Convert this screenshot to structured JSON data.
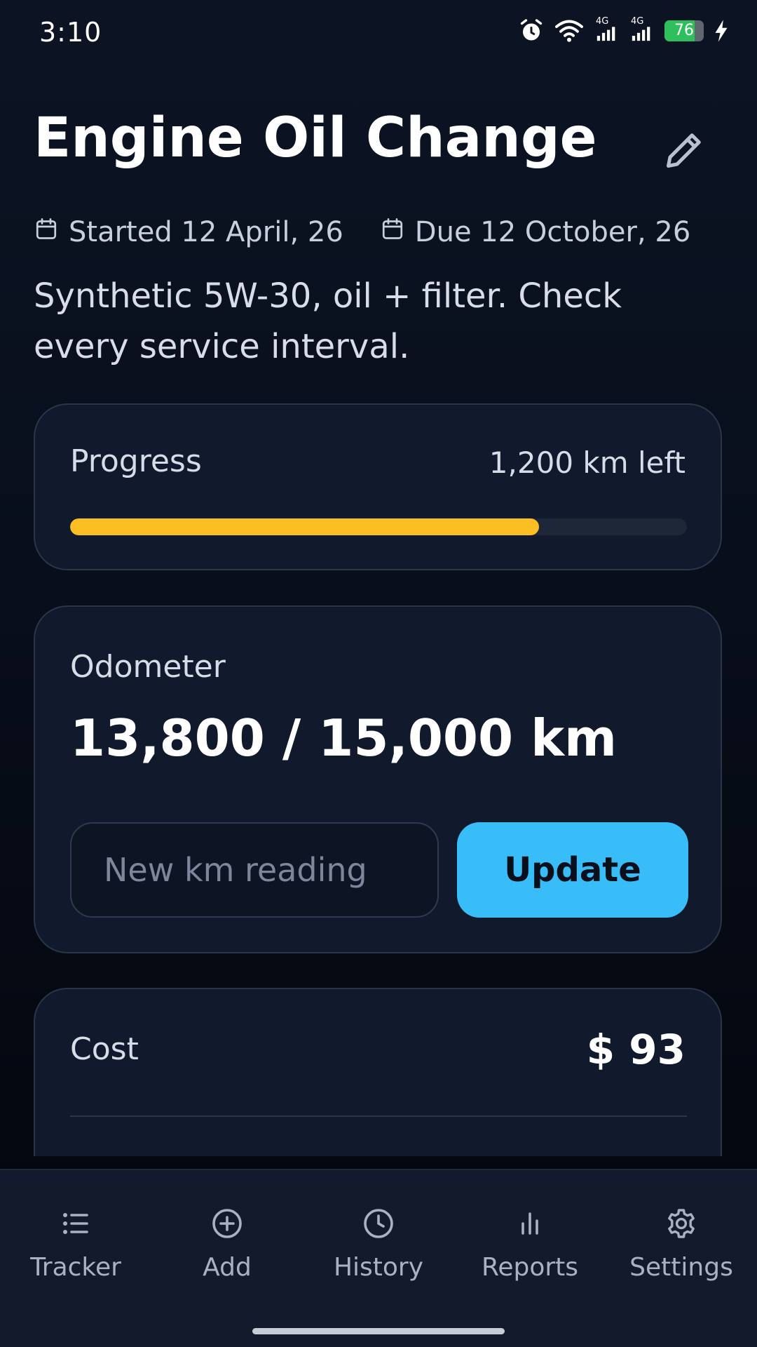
{
  "status_bar": {
    "time": "3:10",
    "network_1": "4G",
    "network_2": "4G",
    "battery_level": "76",
    "icons": [
      "alarm-icon",
      "wifi-icon",
      "signal-icon",
      "signal-icon",
      "battery-icon",
      "charging-icon"
    ],
    "colors": {
      "battery": "#2fbf5c"
    }
  },
  "header": {
    "title": "Engine Oil Change",
    "edit_icon": "pencil-icon",
    "started": "Started 12 April, 26",
    "due": "Due 12 October, 26",
    "description": "Synthetic 5W-30, oil + filter. Check every service interval."
  },
  "progress": {
    "label": "Progress",
    "remaining": "1,200 km left",
    "fraction": 0.76,
    "color": "#fbbf24"
  },
  "odometer": {
    "label": "Odometer",
    "value": "13,800 / 15,000 km",
    "input_placeholder": "New km reading",
    "input_value": "",
    "update_label": "Update",
    "button_color": "#38bdf8"
  },
  "cost": {
    "label": "Cost",
    "value": "$ 93"
  },
  "nav": {
    "items": [
      {
        "label": "Tracker",
        "icon": "list-icon"
      },
      {
        "label": "Add",
        "icon": "plus-circle-icon"
      },
      {
        "label": "History",
        "icon": "clock-icon"
      },
      {
        "label": "Reports",
        "icon": "bar-chart-icon"
      },
      {
        "label": "Settings",
        "icon": "gear-icon"
      }
    ]
  }
}
